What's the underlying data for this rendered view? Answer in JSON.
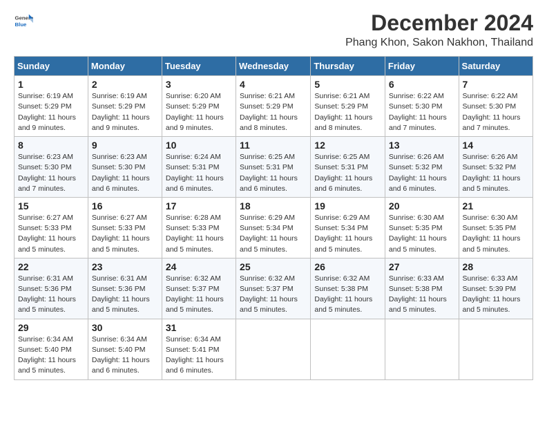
{
  "header": {
    "logo_general": "General",
    "logo_blue": "Blue",
    "main_title": "December 2024",
    "subtitle": "Phang Khon, Sakon Nakhon, Thailand"
  },
  "calendar": {
    "weekdays": [
      "Sunday",
      "Monday",
      "Tuesday",
      "Wednesday",
      "Thursday",
      "Friday",
      "Saturday"
    ],
    "rows": [
      [
        {
          "day": "1",
          "sunrise": "6:19 AM",
          "sunset": "5:29 PM",
          "daylight": "11 hours and 9 minutes."
        },
        {
          "day": "2",
          "sunrise": "6:19 AM",
          "sunset": "5:29 PM",
          "daylight": "11 hours and 9 minutes."
        },
        {
          "day": "3",
          "sunrise": "6:20 AM",
          "sunset": "5:29 PM",
          "daylight": "11 hours and 9 minutes."
        },
        {
          "day": "4",
          "sunrise": "6:21 AM",
          "sunset": "5:29 PM",
          "daylight": "11 hours and 8 minutes."
        },
        {
          "day": "5",
          "sunrise": "6:21 AM",
          "sunset": "5:29 PM",
          "daylight": "11 hours and 8 minutes."
        },
        {
          "day": "6",
          "sunrise": "6:22 AM",
          "sunset": "5:30 PM",
          "daylight": "11 hours and 7 minutes."
        },
        {
          "day": "7",
          "sunrise": "6:22 AM",
          "sunset": "5:30 PM",
          "daylight": "11 hours and 7 minutes."
        }
      ],
      [
        {
          "day": "8",
          "sunrise": "6:23 AM",
          "sunset": "5:30 PM",
          "daylight": "11 hours and 7 minutes."
        },
        {
          "day": "9",
          "sunrise": "6:23 AM",
          "sunset": "5:30 PM",
          "daylight": "11 hours and 6 minutes."
        },
        {
          "day": "10",
          "sunrise": "6:24 AM",
          "sunset": "5:31 PM",
          "daylight": "11 hours and 6 minutes."
        },
        {
          "day": "11",
          "sunrise": "6:25 AM",
          "sunset": "5:31 PM",
          "daylight": "11 hours and 6 minutes."
        },
        {
          "day": "12",
          "sunrise": "6:25 AM",
          "sunset": "5:31 PM",
          "daylight": "11 hours and 6 minutes."
        },
        {
          "day": "13",
          "sunrise": "6:26 AM",
          "sunset": "5:32 PM",
          "daylight": "11 hours and 6 minutes."
        },
        {
          "day": "14",
          "sunrise": "6:26 AM",
          "sunset": "5:32 PM",
          "daylight": "11 hours and 5 minutes."
        }
      ],
      [
        {
          "day": "15",
          "sunrise": "6:27 AM",
          "sunset": "5:33 PM",
          "daylight": "11 hours and 5 minutes."
        },
        {
          "day": "16",
          "sunrise": "6:27 AM",
          "sunset": "5:33 PM",
          "daylight": "11 hours and 5 minutes."
        },
        {
          "day": "17",
          "sunrise": "6:28 AM",
          "sunset": "5:33 PM",
          "daylight": "11 hours and 5 minutes."
        },
        {
          "day": "18",
          "sunrise": "6:29 AM",
          "sunset": "5:34 PM",
          "daylight": "11 hours and 5 minutes."
        },
        {
          "day": "19",
          "sunrise": "6:29 AM",
          "sunset": "5:34 PM",
          "daylight": "11 hours and 5 minutes."
        },
        {
          "day": "20",
          "sunrise": "6:30 AM",
          "sunset": "5:35 PM",
          "daylight": "11 hours and 5 minutes."
        },
        {
          "day": "21",
          "sunrise": "6:30 AM",
          "sunset": "5:35 PM",
          "daylight": "11 hours and 5 minutes."
        }
      ],
      [
        {
          "day": "22",
          "sunrise": "6:31 AM",
          "sunset": "5:36 PM",
          "daylight": "11 hours and 5 minutes."
        },
        {
          "day": "23",
          "sunrise": "6:31 AM",
          "sunset": "5:36 PM",
          "daylight": "11 hours and 5 minutes."
        },
        {
          "day": "24",
          "sunrise": "6:32 AM",
          "sunset": "5:37 PM",
          "daylight": "11 hours and 5 minutes."
        },
        {
          "day": "25",
          "sunrise": "6:32 AM",
          "sunset": "5:37 PM",
          "daylight": "11 hours and 5 minutes."
        },
        {
          "day": "26",
          "sunrise": "6:32 AM",
          "sunset": "5:38 PM",
          "daylight": "11 hours and 5 minutes."
        },
        {
          "day": "27",
          "sunrise": "6:33 AM",
          "sunset": "5:38 PM",
          "daylight": "11 hours and 5 minutes."
        },
        {
          "day": "28",
          "sunrise": "6:33 AM",
          "sunset": "5:39 PM",
          "daylight": "11 hours and 5 minutes."
        }
      ],
      [
        {
          "day": "29",
          "sunrise": "6:34 AM",
          "sunset": "5:40 PM",
          "daylight": "11 hours and 5 minutes."
        },
        {
          "day": "30",
          "sunrise": "6:34 AM",
          "sunset": "5:40 PM",
          "daylight": "11 hours and 6 minutes."
        },
        {
          "day": "31",
          "sunrise": "6:34 AM",
          "sunset": "5:41 PM",
          "daylight": "11 hours and 6 minutes."
        },
        null,
        null,
        null,
        null
      ]
    ]
  }
}
